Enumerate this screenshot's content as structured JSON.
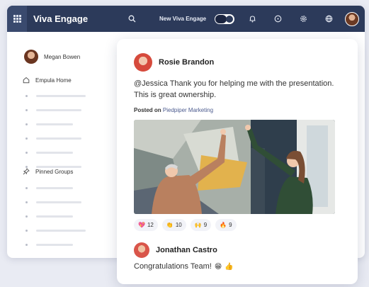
{
  "app": {
    "title": "Viva Engage"
  },
  "topbar": {
    "new_label": "New Viva Engage"
  },
  "sidebar": {
    "user_name": "Megan Bowen",
    "home_label": "Empula Home",
    "pinned_label": "Pinned Groups"
  },
  "post": {
    "author": "Rosie Brandon",
    "text": "@Jessica Thank you for helping me with the presentation. This is great ownership.",
    "posted_on_label": "Posted on",
    "group": "Piedpiper Marketing",
    "reactions": [
      {
        "emoji": "💖",
        "count": "12"
      },
      {
        "emoji": "👏",
        "count": "10"
      },
      {
        "emoji": "🙌",
        "count": "9"
      },
      {
        "emoji": "🔥",
        "count": "9"
      }
    ]
  },
  "comment": {
    "author": "Jonathan Castro",
    "text": "Congratulations Team!",
    "emoji_1": "😁",
    "emoji_2": "👍"
  },
  "colors": {
    "topbar": "#2c3a5a",
    "link": "#4b5a8e",
    "accent": "#d64a3c"
  },
  "icons": [
    "waffle-icon",
    "search-icon",
    "bell-icon",
    "help-icon",
    "gear-icon",
    "globe-icon",
    "home-icon",
    "pin-icon"
  ]
}
